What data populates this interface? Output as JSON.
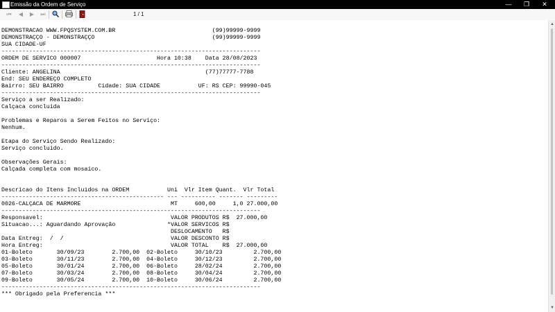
{
  "window": {
    "title": "Emissão da Ordem de Serviço",
    "minimize": "—",
    "maximize": "❐",
    "close": "✕"
  },
  "toolbar": {
    "first_icon": "first-page-icon",
    "prev_icon": "prev-page-icon",
    "next_icon": "next-page-icon",
    "last_icon": "last-page-icon",
    "zoom_icon": "zoom-icon",
    "print_icon": "print-icon",
    "exit_icon": "exit-icon",
    "page_indicator": "1 / 1"
  },
  "report": {
    "lines": [
      "DEMONSTRACAO WWW.FPQSYSTEM.COM.BR                            (99)99999-9999",
      "DEMONSTRAÇÇO - DEMONSTRAÇÇO                                  (99)99999-9999",
      "SUA CIDADE-UF",
      "---------------------------------------------------------------------------",
      "ORDEM DE SERVICO 000007                      Hora 10:38    Data 28/08/2023",
      "---------------------------------------------------------------------------",
      "Cliente: ANGELINA                                          (77)77777-7788",
      "End: SEU ENDEREÇO COMPLETO",
      "Bairro: SEU BAIRRO          Cidade: SUA CIDADE           UF: RS CEP: 99990-045",
      "---------------------------------------------------------------------------",
      "Serviço a ser Realizado:",
      "Calçaca concluida",
      "",
      "Problemas e Reparos a Serem Feitos no Serviço:",
      "Nenhum.",
      "",
      "Etapa do Serviço Sendo Realizado:",
      "Serviço concluido.",
      "",
      "Observações Gerais:",
      "Calçada completa com mosaico.",
      "",
      "",
      "Descricao do Itens Incluidos na ORDEM           Uni  Vlr Item Quant.  Vlr Total",
      "----------------------------------------------- --- ---------- ------- ---------",
      "0026-CALÇACA DE MARMORE                          MT     600,00     1,0 27.000,00",
      "---------------------------------------------------------------------------",
      "Responsavel:                                     VALOR PRODUTOS R$  27.000,00",
      "Situacao...: Aguardando Aprovação               *VALOR SERVICOS R$",
      "                                                 DESLOCAMENTO   R$",
      "Data Entreg:  /  /                               VALOR DESCONTO R$",
      "Hora Entreg:                                     VALOR TOTAL    R$  27.000,00",
      "01-Boleto       30/09/23        2.700,00  02-Boleto     30/10/23         2.700,00",
      "03-Boleto       30/11/23        2.700,00  04-Boleto     30/12/23         2.700,00",
      "05-Boleto       30/01/24        2.700,00  06-Boleto     28/02/24         2.700,00",
      "07-Boleto       30/03/24        2.700,00  08-Boleto     30/04/24         2.700,00",
      "09-Boleto       30/05/24        2.700,00  10-Boleto     30/06/24         2.700,00",
      "---------------------------------------------------------------------------",
      "*** Obrigado pela Preferencia ***"
    ]
  }
}
